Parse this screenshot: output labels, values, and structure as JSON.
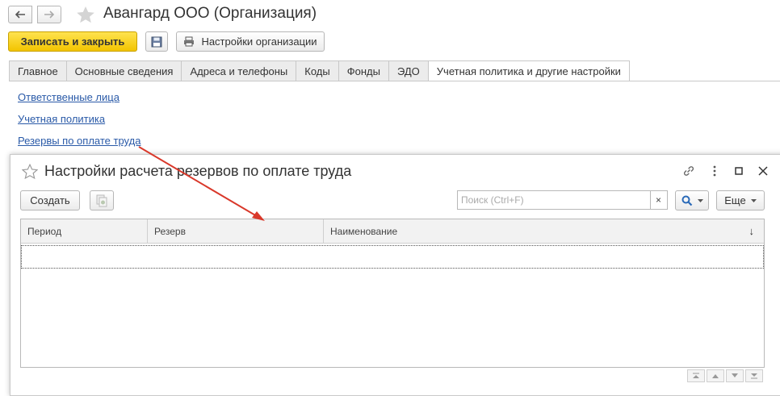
{
  "window": {
    "title": "Авангард ООО (Организация)"
  },
  "toolbar": {
    "save_close_label": "Записать и закрыть",
    "settings_label": "Настройки организации"
  },
  "tabs": [
    {
      "label": "Главное"
    },
    {
      "label": "Основные сведения"
    },
    {
      "label": "Адреса и телефоны"
    },
    {
      "label": "Коды"
    },
    {
      "label": "Фонды"
    },
    {
      "label": "ЭДО"
    },
    {
      "label": "Учетная политика и другие настройки",
      "active": true
    }
  ],
  "links": [
    {
      "label": "Ответственные лица"
    },
    {
      "label": "Учетная политика"
    },
    {
      "label": "Резервы по оплате труда"
    }
  ],
  "modal": {
    "title": "Настройки расчета резервов по оплате труда",
    "create_label": "Создать",
    "search_placeholder": "Поиск (Ctrl+F)",
    "clear_label": "×",
    "more_label": "Еще",
    "columns": [
      "Период",
      "Резерв",
      "Наименование"
    ],
    "sort_indicator": "↓"
  },
  "colors": {
    "accent_yellow": "#f2c400",
    "link_blue": "#2a5aa8",
    "arrow_red": "#d9382a"
  }
}
